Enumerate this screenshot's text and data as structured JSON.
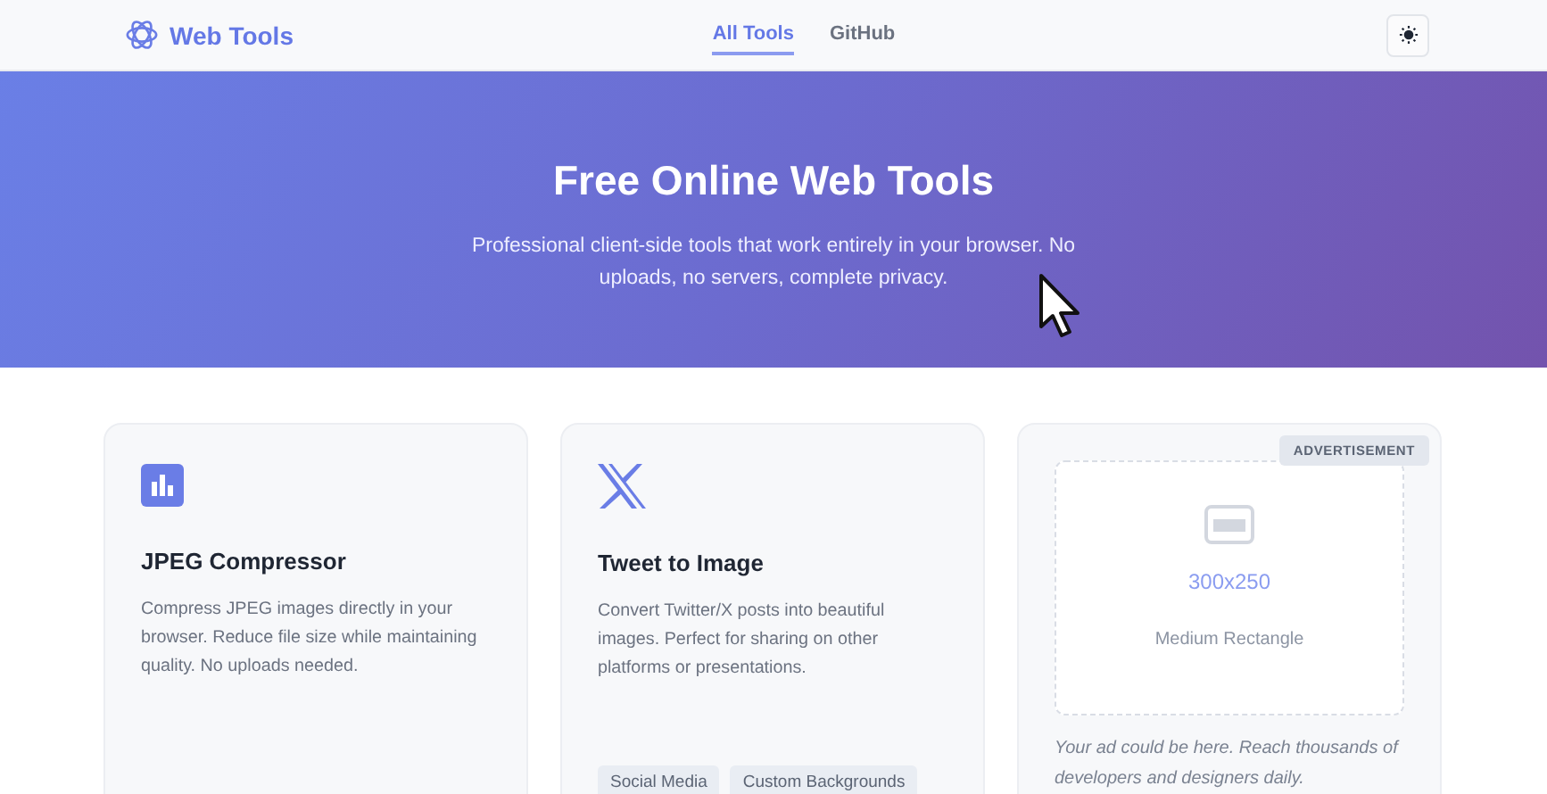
{
  "header": {
    "logo": "Web Tools",
    "nav": [
      {
        "label": "All Tools",
        "selected": true
      },
      {
        "label": "GitHub",
        "selected": false
      }
    ]
  },
  "hero": {
    "title": "Free Online Web Tools",
    "subtitle": "Professional client-side tools that work entirely in your browser. No uploads, no servers, complete privacy."
  },
  "cards": [
    {
      "kind": "tool",
      "title": "JPEG Compressor",
      "description": "Compress JPEG images directly in your browser. Reduce file size while maintaining quality. No uploads needed."
    },
    {
      "kind": "tool",
      "title": "Tweet to Image",
      "description": "Convert Twitter/X posts into beautiful images. Perfect for sharing on other platforms or presentations.",
      "tags": [
        "Social Media",
        "Custom Backgrounds"
      ]
    },
    {
      "kind": "ad",
      "badge": "ADVERTISEMENT",
      "size": "300x250",
      "format": "Medium Rectangle",
      "note": "Your ad could be here. Reach thousands of developers and designers daily."
    }
  ]
}
